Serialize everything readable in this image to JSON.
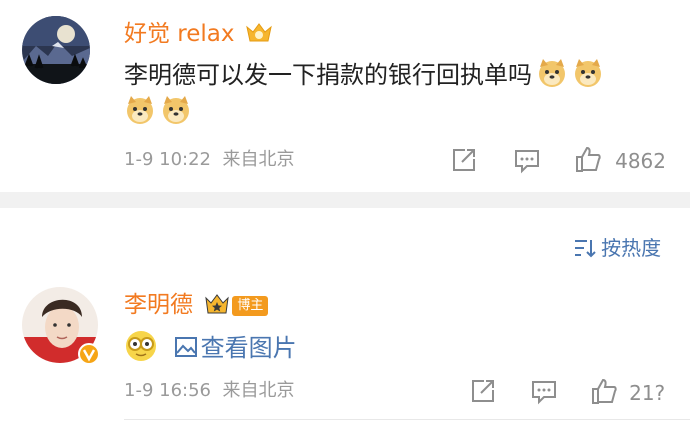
{
  "comments": [
    {
      "username": "好觉 relax",
      "text": "李明德可以发一下捐款的银行回执单吗",
      "timestamp": "1-9 10:22",
      "source": "来自北京",
      "likes": "4862",
      "emoji": "doge"
    },
    {
      "username": "李明德",
      "badge": "博主",
      "image_link": "查看图片",
      "timestamp": "1-9 16:56",
      "source": "来自北京",
      "likes": "21?",
      "emoji": "nerd-face"
    }
  ],
  "sort": {
    "label": "按热度"
  },
  "colors": {
    "username": "#f27a20",
    "link": "#4a76b0",
    "meta": "#9a9a9a",
    "badge": "#f39a1e"
  }
}
